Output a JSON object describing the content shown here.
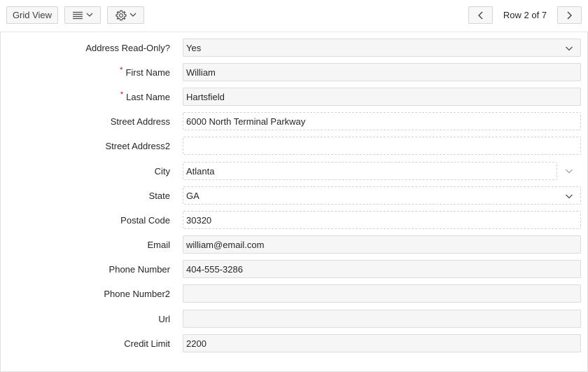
{
  "toolbar": {
    "grid_view_label": "Grid View",
    "row_status": "Row 2 of 7",
    "icons": [
      "menu-lines-icon",
      "chevron-down-icon",
      "gear-icon",
      "chevron-left-icon",
      "chevron-right-icon"
    ]
  },
  "form": {
    "address_readonly": {
      "label": "Address Read-Only?",
      "value": "Yes"
    },
    "first_name": {
      "label": "First Name",
      "required_mark": "*",
      "value": "William"
    },
    "last_name": {
      "label": "Last Name",
      "required_mark": "*",
      "value": "Hartsfield"
    },
    "street_address": {
      "label": "Street Address",
      "value": "6000 North Terminal Parkway"
    },
    "street_address2": {
      "label": "Street Address2",
      "value": ""
    },
    "city": {
      "label": "City",
      "value": "Atlanta"
    },
    "state": {
      "label": "State",
      "value": "GA"
    },
    "postal_code": {
      "label": "Postal Code",
      "value": "30320"
    },
    "email": {
      "label": "Email",
      "value": "william@email.com"
    },
    "phone_number": {
      "label": "Phone Number",
      "value": "404-555-3286"
    },
    "phone_number2": {
      "label": "Phone Number2",
      "value": ""
    },
    "url": {
      "label": "Url",
      "value": ""
    },
    "credit_limit": {
      "label": "Credit Limit",
      "value": "2200"
    }
  },
  "colors": {
    "required": "#d0021b",
    "field_bg": "#f6f6f6",
    "border": "#dcdcdc"
  }
}
